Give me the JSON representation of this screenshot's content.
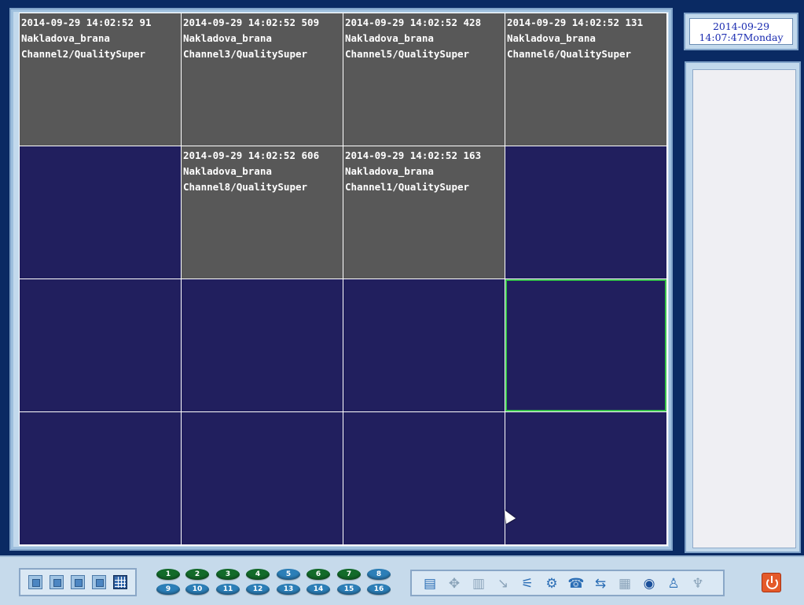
{
  "clock": {
    "date": "2014-09-29",
    "time_day": "14:07:47Monday"
  },
  "tiles": [
    {
      "active": true,
      "timestamp": "2014-09-29 14:02:52 91",
      "site": "Nakladova_brana",
      "channel": "Channel2/QualitySuper"
    },
    {
      "active": true,
      "timestamp": "2014-09-29 14:02:52 509",
      "site": "Nakladova_brana",
      "channel": "Channel3/QualitySuper"
    },
    {
      "active": true,
      "timestamp": "2014-09-29 14:02:52 428",
      "site": "Nakladova_brana",
      "channel": "Channel5/QualitySuper"
    },
    {
      "active": true,
      "timestamp": "2014-09-29 14:02:52 131",
      "site": "Nakladova_brana",
      "channel": "Channel6/QualitySuper"
    },
    {
      "active": false
    },
    {
      "active": true,
      "timestamp": "2014-09-29 14:02:52 606",
      "site": "Nakladova_brana",
      "channel": "Channel8/QualitySuper"
    },
    {
      "active": true,
      "timestamp": "2014-09-29 14:02:52 163",
      "site": "Nakladova_brana",
      "channel": "Channel1/QualitySuper"
    },
    {
      "active": false
    },
    {
      "active": false
    },
    {
      "active": false
    },
    {
      "active": false
    },
    {
      "active": false,
      "selected": true
    },
    {
      "active": false
    },
    {
      "active": false
    },
    {
      "active": false
    },
    {
      "active": false
    }
  ],
  "channels_row1": [
    "1",
    "2",
    "3",
    "4",
    "5",
    "6",
    "7",
    "8"
  ],
  "channels_row2": [
    "9",
    "10",
    "11",
    "12",
    "13",
    "14",
    "15",
    "16"
  ],
  "channels_active": [
    "1",
    "2",
    "3",
    "4",
    "6",
    "7"
  ],
  "layout_buttons": [
    "layout-1-icon",
    "layout-4-icon",
    "layout-6-icon",
    "layout-9-icon",
    "layout-16-icon"
  ],
  "tool_icons": [
    {
      "name": "device-list-icon",
      "glyph": "▤",
      "enabled": true
    },
    {
      "name": "ptz-icon",
      "glyph": "✥",
      "enabled": false
    },
    {
      "name": "record-icon",
      "glyph": "▥",
      "enabled": false
    },
    {
      "name": "playback-icon",
      "glyph": "↘",
      "enabled": false
    },
    {
      "name": "network-icon",
      "glyph": "⚟",
      "enabled": true
    },
    {
      "name": "settings-icon",
      "glyph": "⚙",
      "enabled": true
    },
    {
      "name": "alarm-icon",
      "glyph": "☎",
      "enabled": true
    },
    {
      "name": "usb-icon",
      "glyph": "⇆",
      "enabled": true
    },
    {
      "name": "log-icon",
      "glyph": "▦",
      "enabled": false
    },
    {
      "name": "globe-icon",
      "glyph": "◉",
      "enabled": true
    },
    {
      "name": "users-icon",
      "glyph": "♙",
      "enabled": true
    },
    {
      "name": "microphone-icon",
      "glyph": "♆",
      "enabled": false
    }
  ]
}
